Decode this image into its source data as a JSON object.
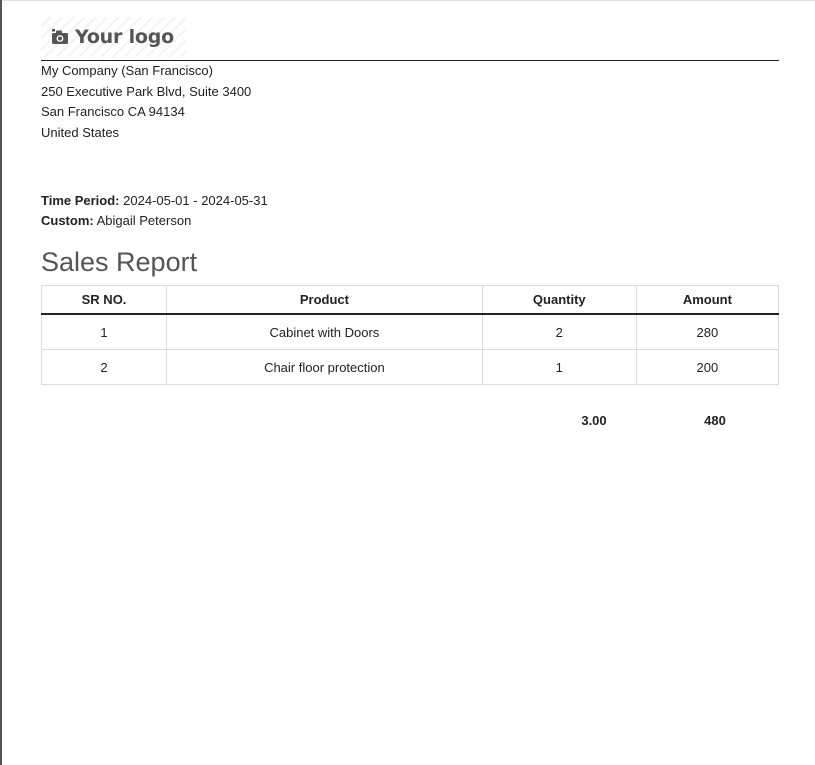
{
  "logo": {
    "text": "Your logo",
    "icon": "camera-icon"
  },
  "company": {
    "name": "My Company (San Francisco)",
    "street": "250 Executive Park Blvd, Suite 3400",
    "city_line": "San Francisco CA 94134",
    "country": "United States"
  },
  "filters": {
    "period_label": "Time Period:",
    "period_value": "2024-05-01 - 2024-05-31",
    "custom_label": "Custom:",
    "custom_value": "Abigail Peterson"
  },
  "report": {
    "title": "Sales Report",
    "columns": [
      "SR NO.",
      "Product",
      "Quantity",
      "Amount"
    ],
    "rows": [
      {
        "sr": "1",
        "product": "Cabinet with Doors",
        "quantity": "2",
        "amount": "280"
      },
      {
        "sr": "2",
        "product": "Chair floor protection",
        "quantity": "1",
        "amount": "200"
      }
    ],
    "totals": {
      "quantity": "3.00",
      "amount": "480"
    }
  },
  "colors": {
    "text": "#222222",
    "title": "#555555",
    "border": "#dcdcdc"
  }
}
